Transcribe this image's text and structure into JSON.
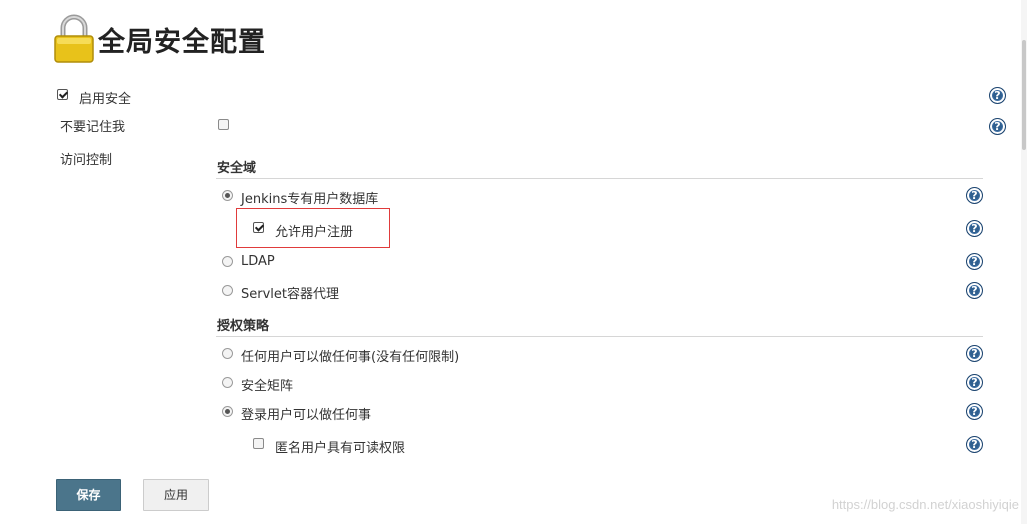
{
  "page": {
    "title": "全局安全配置"
  },
  "options": {
    "enable_security": {
      "label": "启用安全",
      "checked": true
    },
    "disable_remember_me": {
      "label": "不要记住我",
      "checked": false
    },
    "access_control": {
      "label": "访问控制"
    }
  },
  "security_realm": {
    "title": "安全域",
    "items": [
      {
        "label": "Jenkins专有用户数据库",
        "selected": true
      },
      {
        "label": "LDAP",
        "selected": false
      },
      {
        "label": "Servlet容器代理",
        "selected": false
      }
    ],
    "allow_signup": {
      "label": "允许用户注册",
      "checked": true
    }
  },
  "authorization": {
    "title": "授权策略",
    "items": [
      {
        "label": "任何用户可以做任何事(没有任何限制)",
        "selected": false
      },
      {
        "label": "安全矩阵",
        "selected": false
      },
      {
        "label": "登录用户可以做任何事",
        "selected": true
      }
    ],
    "anonymous_read": {
      "label": "匿名用户具有可读权限",
      "checked": false
    }
  },
  "buttons": {
    "save": "保存",
    "apply": "应用"
  },
  "help": {
    "glyph": "?"
  },
  "watermark": "https://blog.csdn.net/xiaoshiyiqie",
  "colors": {
    "save_button": "#4b758b",
    "help_icon": "#2f5f8f",
    "highlight": "#e03b3b"
  }
}
